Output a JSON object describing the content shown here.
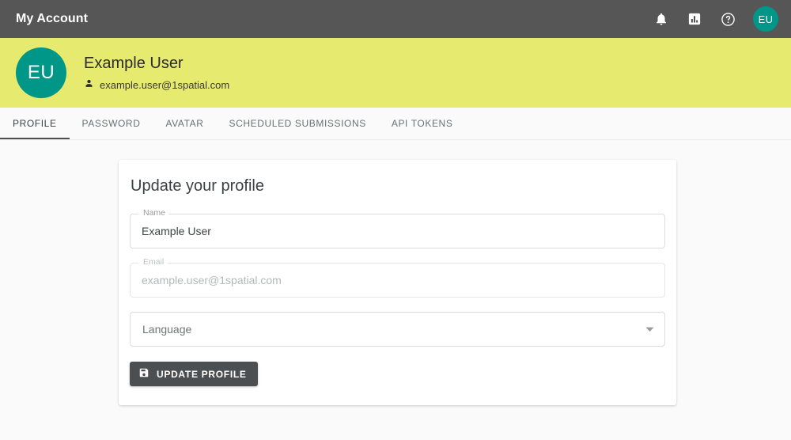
{
  "appbar": {
    "title": "My Account",
    "icons": [
      {
        "name": "notifications-bell-icon",
        "label": "Notifications"
      },
      {
        "name": "bar-chart-icon",
        "label": "Statistics"
      },
      {
        "name": "help-circle-icon",
        "label": "Help"
      }
    ],
    "avatar_initials": "EU",
    "bg_color": "#565656"
  },
  "banner": {
    "avatar_initials": "EU",
    "avatar_color": "#009688",
    "name": "Example User",
    "email": "example.user@1spatial.com",
    "bg_color": "#e6ea6f"
  },
  "tabs": [
    {
      "label": "PROFILE",
      "active": true
    },
    {
      "label": "PASSWORD",
      "active": false
    },
    {
      "label": "AVATAR",
      "active": false
    },
    {
      "label": "SCHEDULED SUBMISSIONS",
      "active": false
    },
    {
      "label": "API TOKENS",
      "active": false
    }
  ],
  "card": {
    "title": "Update your profile",
    "name_field": {
      "label": "Name",
      "value": "Example User"
    },
    "email_field": {
      "label": "Email",
      "value": "example.user@1spatial.com",
      "disabled": true
    },
    "language_select": {
      "placeholder": "Language",
      "value": "Language"
    },
    "submit_button": {
      "label": "UPDATE PROFILE",
      "icon": "save-floppy-icon",
      "bg_color": "#4c4f52"
    }
  }
}
